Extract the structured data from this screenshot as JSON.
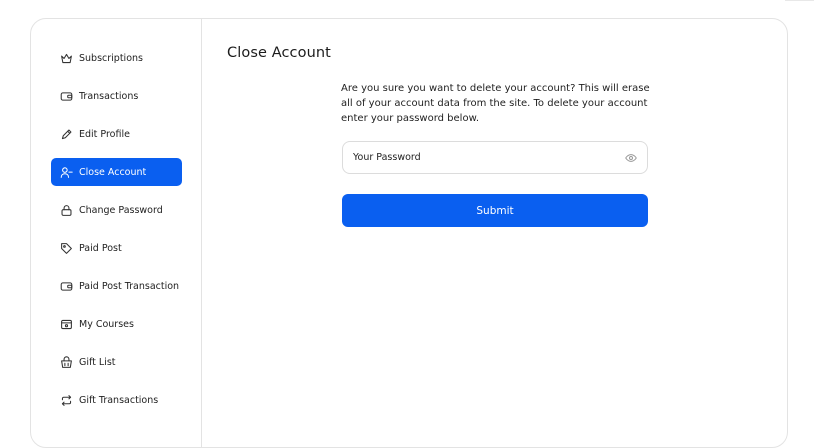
{
  "sidebar": {
    "items": [
      {
        "label": "Subscriptions",
        "icon": "crown-icon",
        "active": false
      },
      {
        "label": "Transactions",
        "icon": "wallet-icon",
        "active": false
      },
      {
        "label": "Edit Profile",
        "icon": "pencil-icon",
        "active": false
      },
      {
        "label": "Close Account",
        "icon": "user-minus-icon",
        "active": true
      },
      {
        "label": "Change Password",
        "icon": "lock-icon",
        "active": false
      },
      {
        "label": "Paid Post",
        "icon": "tag-icon",
        "active": false
      },
      {
        "label": "Paid Post Transaction",
        "icon": "wallet-icon",
        "active": false
      },
      {
        "label": "My Courses",
        "icon": "box-icon",
        "active": false
      },
      {
        "label": "Gift List",
        "icon": "basket-icon",
        "active": false
      },
      {
        "label": "Gift Transactions",
        "icon": "repeat-icon",
        "active": false
      }
    ]
  },
  "main": {
    "title": "Close Account",
    "description": "Are you sure you want to delete your account? This will erase all of your account data from the site. To delete your account enter your password below.",
    "password_placeholder": "Your Password",
    "submit_label": "Submit"
  },
  "colors": {
    "accent": "#0a5ff0",
    "border": "#e3e3e3"
  }
}
